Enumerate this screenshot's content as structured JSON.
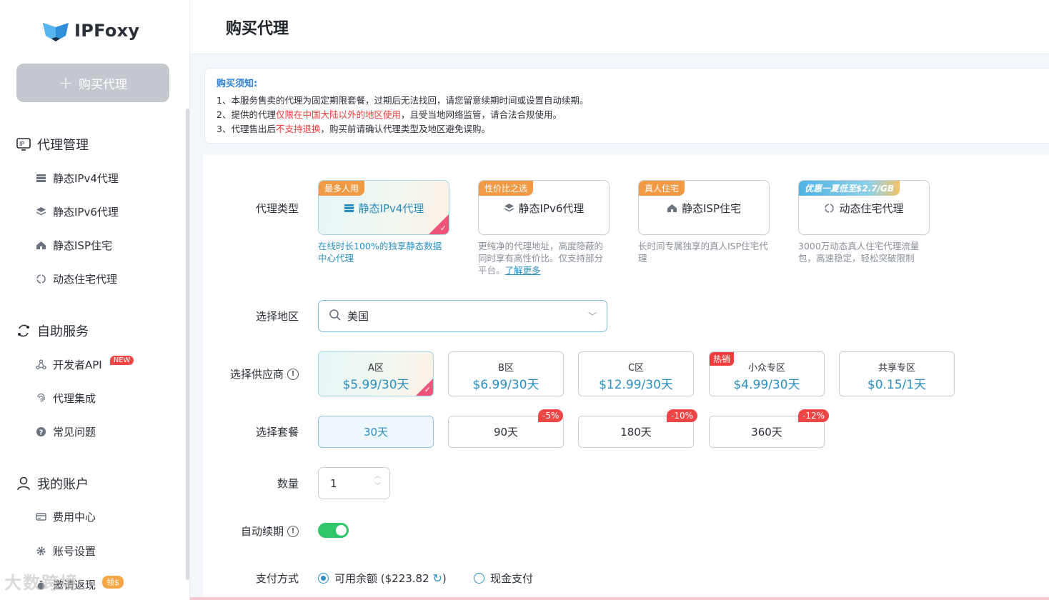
{
  "brand": {
    "name": "IPFoxy"
  },
  "sidebar": {
    "buy_button": "购买代理",
    "groups": [
      {
        "label": "代理管理",
        "items": [
          {
            "label": "静态IPv4代理"
          },
          {
            "label": "静态IPv6代理"
          },
          {
            "label": "静态ISP住宅"
          },
          {
            "label": "动态住宅代理"
          }
        ]
      },
      {
        "label": "自助服务",
        "items": [
          {
            "label": "开发者API",
            "badge": "NEW"
          },
          {
            "label": "代理集成"
          },
          {
            "label": "常见问题"
          }
        ]
      },
      {
        "label": "我的账户",
        "items": [
          {
            "label": "费用中心"
          },
          {
            "label": "账号设置"
          },
          {
            "label": "邀请返现",
            "badge": "领$"
          }
        ]
      }
    ]
  },
  "header": {
    "title": "购买代理"
  },
  "notice": {
    "title": "购买须知:",
    "line1": "1、本服务售卖的代理为固定期限套餐，过期后无法找回，请您留意续期时间或设置自动续期。",
    "line2_a": "2、提供的代理",
    "line2_red": "仅限在中国大陆以外的地区使用",
    "line2_b": "，且受当地网络监管，请合法合规使用。",
    "line3_a": "3、代理售出后",
    "line3_red": "不支持退换",
    "line3_b": "，购买前请确认代理类型及地区避免误购。"
  },
  "form": {
    "labels": {
      "type": "代理类型",
      "region": "选择地区",
      "supplier": "选择供应商",
      "plan": "选择套餐",
      "quantity": "数量",
      "auto_renew": "自动续期",
      "payment": "支付方式"
    },
    "types": [
      {
        "tag": "最多人用",
        "name": "静态IPv4代理",
        "desc": "在线时长100%的独享静态数据中心代理",
        "selected": true
      },
      {
        "tag": "性价比之选",
        "name": "静态IPv6代理",
        "desc": "更纯净的代理地址，高度隐蔽的同时享有高性价比。仅支持部分平台。",
        "link": "了解更多"
      },
      {
        "tag": "真人住宅",
        "name": "静态ISP住宅",
        "desc": "长时间专属独享的真人ISP住宅代理"
      },
      {
        "tag": "优惠一夏低至$2.7/GB",
        "name": "动态住宅代理",
        "desc": "3000万动态真人住宅代理流量包，高速稳定，轻松突破限制"
      }
    ],
    "region": {
      "value": "美国"
    },
    "suppliers": [
      {
        "name": "A区",
        "price": "$5.99/30天",
        "selected": true
      },
      {
        "name": "B区",
        "price": "$6.99/30天"
      },
      {
        "name": "C区",
        "price": "$12.99/30天"
      },
      {
        "name": "小众专区",
        "price": "$4.99/30天",
        "tag": "热销"
      },
      {
        "name": "共享专区",
        "price": "$0.15/1天"
      }
    ],
    "plans": [
      {
        "label": "30天",
        "selected": true
      },
      {
        "label": "90天",
        "discount": "-5%"
      },
      {
        "label": "180天",
        "discount": "-10%"
      },
      {
        "label": "360天",
        "discount": "-12%"
      }
    ],
    "quantity": "1",
    "auto_renew": true,
    "payment": {
      "balance_label": "可用余额 ($223.82",
      "balance_close": ")",
      "cash_label": "现金支付"
    }
  },
  "watermark": "大数跨境",
  "colors": {
    "accent": "#2a8fc0",
    "tag_orange": "#f19a45",
    "red": "#ee3b3b",
    "toggle_green": "#2fc66a"
  }
}
